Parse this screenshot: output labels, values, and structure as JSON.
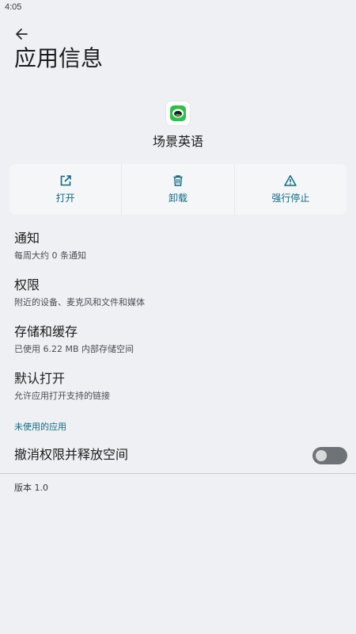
{
  "status_bar": {
    "time": "4:05"
  },
  "header": {
    "title": "应用信息"
  },
  "app": {
    "name": "场景英语",
    "icon": "app-logo-icon",
    "icon_color": "#2fbf4a"
  },
  "actions": [
    {
      "label": "打开",
      "icon": "open-external-icon"
    },
    {
      "label": "卸载",
      "icon": "trash-icon"
    },
    {
      "label": "强行停止",
      "icon": "warning-icon"
    }
  ],
  "settings": [
    {
      "title": "通知",
      "subtitle": "每周大约 0 条通知"
    },
    {
      "title": "权限",
      "subtitle": "附近的设备、麦克风和文件和媒体"
    },
    {
      "title": "存储和缓存",
      "subtitle": "已使用 6.22 MB 内部存储空间"
    },
    {
      "title": "默认打开",
      "subtitle": "允许应用打开支持的链接"
    }
  ],
  "unused_section": {
    "header": "未使用的应用",
    "toggle_label": "撤消权限并释放空间",
    "toggle_on": false
  },
  "footer": {
    "version": "版本 1.0"
  },
  "colors": {
    "accent": "#0f6b85",
    "background": "#eef0f3"
  }
}
